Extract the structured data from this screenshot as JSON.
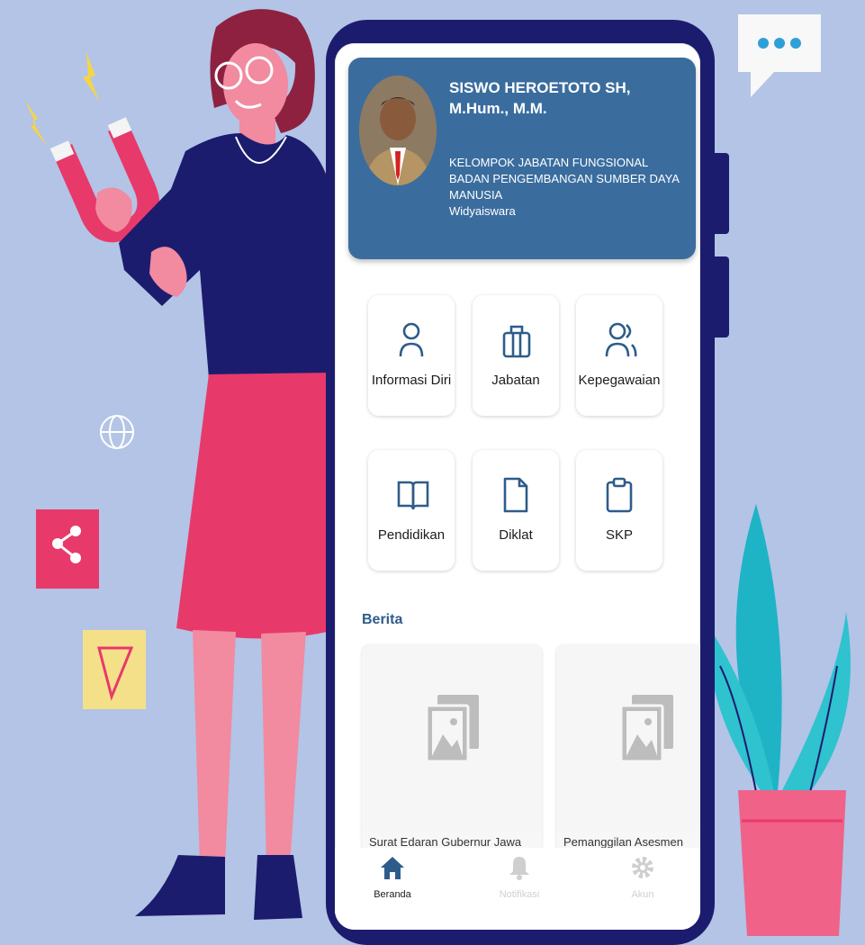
{
  "profile": {
    "name": "SISWO HEROETOTO SH, M.Hum., M.M.",
    "unit": "KELOMPOK JABATAN FUNGSIONAL",
    "department": "BADAN PENGEMBANGAN SUMBER DAYA MANUSIA",
    "position": "Widyaiswara"
  },
  "menu": [
    {
      "label": "Informasi Diri",
      "icon": "user-icon"
    },
    {
      "label": "Jabatan",
      "icon": "briefcase-icon"
    },
    {
      "label": "Kepegawaian",
      "icon": "users-icon"
    },
    {
      "label": "Pendidikan",
      "icon": "book-icon"
    },
    {
      "label": "Diklat",
      "icon": "file-icon"
    },
    {
      "label": "SKP",
      "icon": "clipboard-icon"
    }
  ],
  "news": {
    "heading": "Berita",
    "items": [
      {
        "title": "Surat Edaran Gubernur Jawa"
      },
      {
        "title": "Pemanggilan Asesmen"
      }
    ]
  },
  "nav": [
    {
      "label": "Beranda",
      "icon": "home-icon",
      "active": true
    },
    {
      "label": "Notifikasi",
      "icon": "bell-icon",
      "active": false
    },
    {
      "label": "Akun",
      "icon": "gear-icon",
      "active": false
    }
  ],
  "colors": {
    "background": "#b3c4e6",
    "phone_frame": "#1c1c6e",
    "profile_card": "#3a6d9e",
    "accent_blue": "#2e5c8a",
    "pink": "#e8396b"
  }
}
